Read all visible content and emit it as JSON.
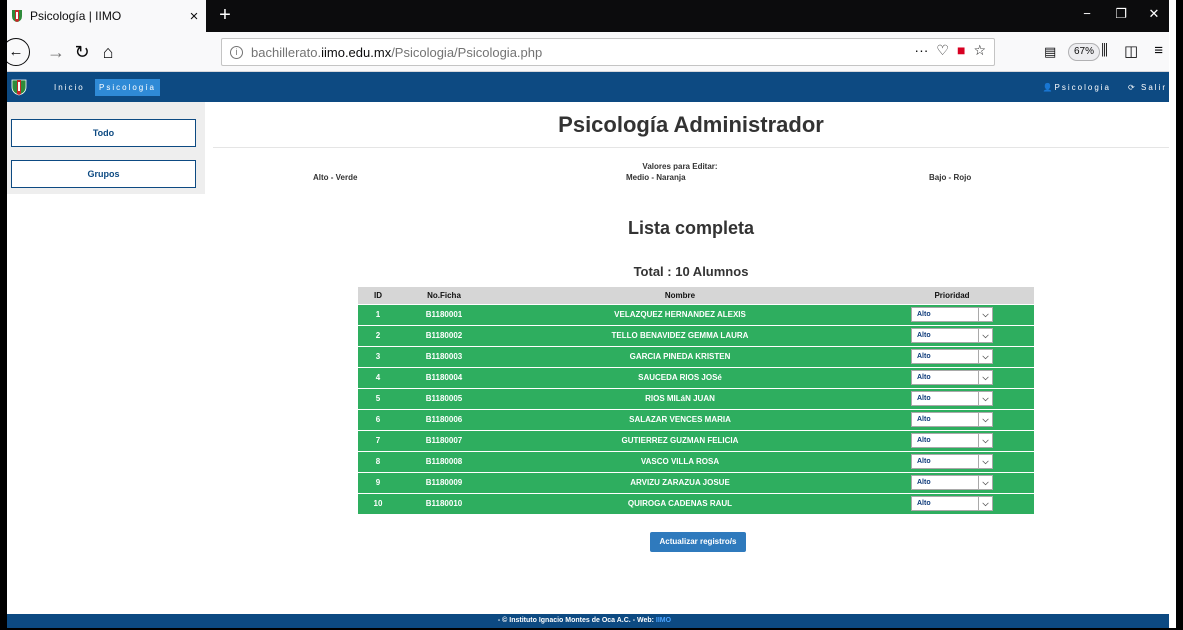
{
  "browser": {
    "tab_title": "Psicología | IIMO",
    "tab_close": "×",
    "new_tab": "+",
    "url_prefix": "bachillerato.",
    "url_domain": "iimo.edu.mx",
    "url_path": "/Psicologia/Psicologia.php",
    "zoom": "67%",
    "window_minimize": "−",
    "window_restore": "❐",
    "window_close": "✕"
  },
  "header": {
    "nav": [
      "Inicio",
      "Psicología"
    ],
    "user": "Psicologia",
    "logout": "Salir",
    "brand_color": "#0d4a82",
    "active_color": "#2f8ad6"
  },
  "sidebar": {
    "items": [
      "Todo",
      "Grupos"
    ]
  },
  "main": {
    "title": "Psicología Administrador",
    "legend_title": "Valores para Editar:",
    "legend_high": "Alto - Verde",
    "legend_medium": "Medio - Naranja",
    "legend_low": "Bajo - Rojo",
    "subtitle": "Lista completa",
    "total": "Total : 10 Alumnos",
    "update_button": "Actualizar registro/s"
  },
  "table": {
    "headers": [
      "ID",
      "No.Ficha",
      "Nombre",
      "Prioridad"
    ],
    "row_color": "#2eae5f",
    "rows": [
      {
        "id": "1",
        "ficha": "B1180001",
        "nombre": "VELAZQUEZ HERNANDEZ ALEXIS",
        "prioridad": "Alto"
      },
      {
        "id": "2",
        "ficha": "B1180002",
        "nombre": "TELLO BENAVIDEZ GEMMA LAURA",
        "prioridad": "Alto"
      },
      {
        "id": "3",
        "ficha": "B1180003",
        "nombre": "GARCIA PINEDA KRISTEN",
        "prioridad": "Alto"
      },
      {
        "id": "4",
        "ficha": "B1180004",
        "nombre": "SAUCEDA RIOS JOSé",
        "prioridad": "Alto"
      },
      {
        "id": "5",
        "ficha": "B1180005",
        "nombre": "RIOS MILáN JUAN",
        "prioridad": "Alto"
      },
      {
        "id": "6",
        "ficha": "B1180006",
        "nombre": "SALAZAR VENCES MARIA",
        "prioridad": "Alto"
      },
      {
        "id": "7",
        "ficha": "B1180007",
        "nombre": "GUTIERREZ GUZMAN FELICIA",
        "prioridad": "Alto"
      },
      {
        "id": "8",
        "ficha": "B1180008",
        "nombre": "VASCO VILLA ROSA",
        "prioridad": "Alto"
      },
      {
        "id": "9",
        "ficha": "B1180009",
        "nombre": "ARVIZU ZARAZUA JOSUE",
        "prioridad": "Alto"
      },
      {
        "id": "10",
        "ficha": "B1180010",
        "nombre": "QUIROGA CADENAS RAUL",
        "prioridad": "Alto"
      }
    ]
  },
  "footer": {
    "text": "- © Instituto Ignacio Montes de Oca A.C.  - Web: ",
    "web": "IIMO"
  }
}
